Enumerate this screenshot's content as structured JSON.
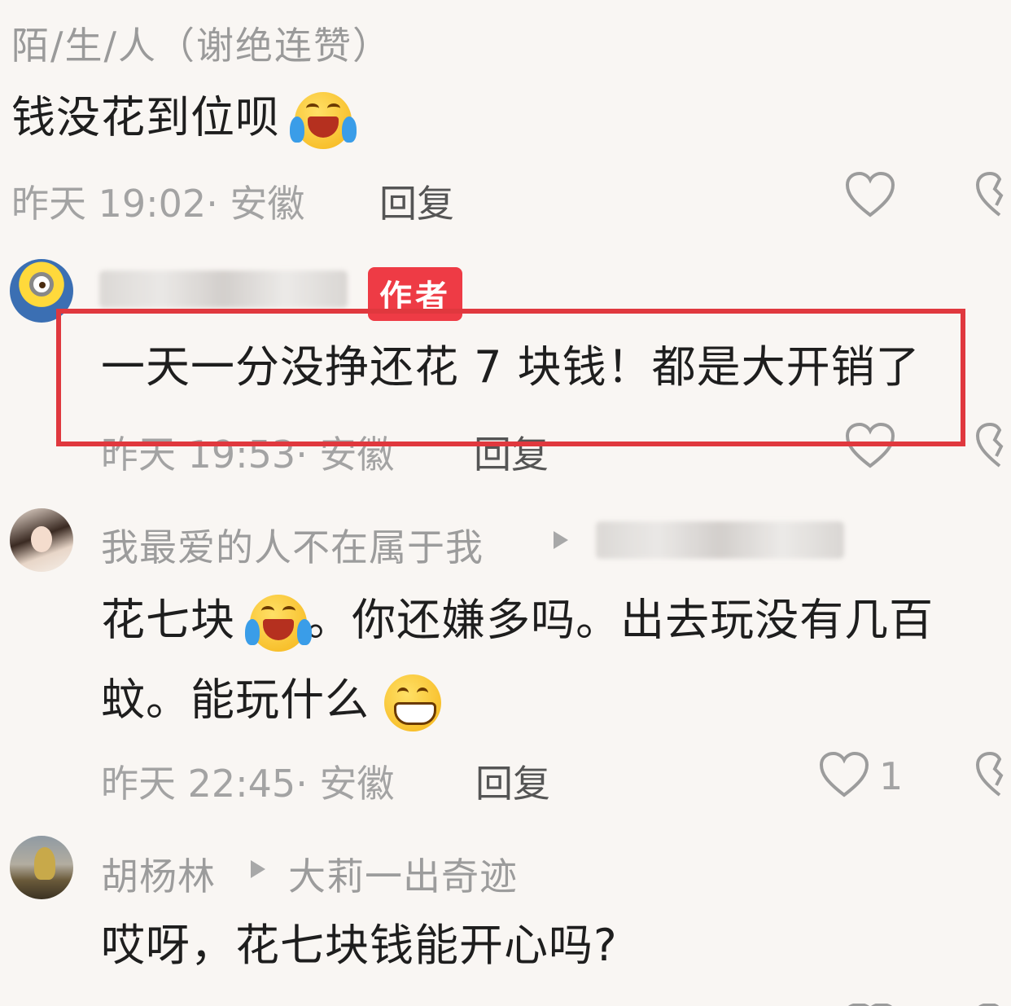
{
  "comments": [
    {
      "author": "陌/生/人（谢绝连赞）",
      "text": "钱没花到位呗",
      "emoji": "laugh-cry-emoji",
      "time": "昨天 19:02",
      "location": "· 安徽",
      "reply_label": "回复"
    },
    {
      "author_badge": "作者",
      "text": "一天一分没挣还花 7 块钱！都是大开销了",
      "time": "昨天 19:53",
      "location": "· 安徽",
      "reply_label": "回复"
    },
    {
      "author": "我最爱的人不在属于我",
      "text_part1": "花七块",
      "text_part2": "。你还嫌多吗。出去玩没有几百",
      "text_line2": "蚊。能玩什么",
      "time": "昨天 22:45",
      "location": "· 安徽",
      "reply_label": "回复",
      "like_count": "1"
    },
    {
      "author": "胡杨林",
      "reply_to": "大莉一出奇迹",
      "text": "哎呀，花七块钱能开心吗?"
    }
  ],
  "colors": {
    "highlight": "#e0383e",
    "badge": "#ee3b45",
    "background": "#f9f6f3"
  }
}
